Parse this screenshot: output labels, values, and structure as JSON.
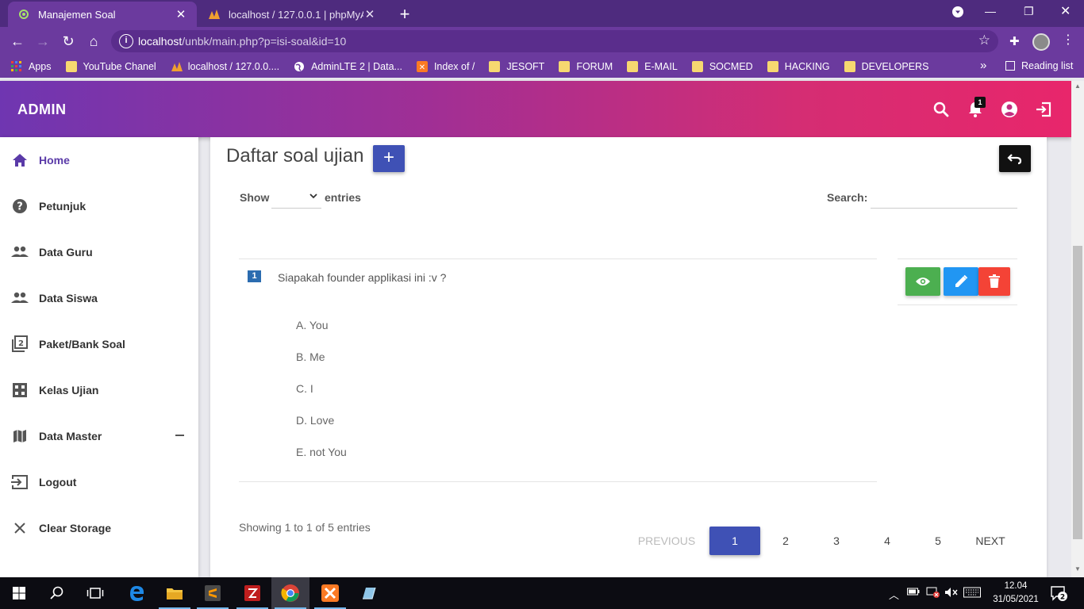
{
  "browser": {
    "tabs": [
      {
        "title": "Manajemen Soal",
        "active": true
      },
      {
        "title": "localhost / 127.0.0.1 | phpMyAdmin",
        "active": false
      }
    ],
    "url_host": "localhost",
    "url_path": "/unbk/main.php?p=isi-soal&id=10",
    "bookmarks": [
      "Apps",
      "YouTube Chanel",
      "localhost / 127.0.0....",
      "AdminLTE 2 | Data...",
      "Index of /",
      "JESOFT",
      "FORUM",
      "E-MAIL",
      "SOCMED",
      "HACKING",
      "DEVELOPERS"
    ],
    "more_bookmarks": "»",
    "reading_list": "Reading list"
  },
  "header": {
    "brand": "ADMIN",
    "notification_count": "1"
  },
  "sidebar": {
    "items": [
      {
        "label": "Home",
        "icon": "home-icon",
        "active": true
      },
      {
        "label": "Petunjuk",
        "icon": "help-icon"
      },
      {
        "label": "Data Guru",
        "icon": "people-icon"
      },
      {
        "label": "Data Siswa",
        "icon": "people-icon"
      },
      {
        "label": "Paket/Bank Soal",
        "icon": "filter-2-icon"
      },
      {
        "label": "Kelas Ujian",
        "icon": "class-icon"
      },
      {
        "label": "Data Master",
        "icon": "map-icon"
      },
      {
        "label": "Logout",
        "icon": "logout-icon"
      },
      {
        "label": "Clear Storage",
        "icon": "close-icon"
      }
    ]
  },
  "main": {
    "title": "Daftar soal ujian",
    "add_label": "+",
    "show_label": "Show",
    "entries_label": "entries",
    "search_label": "Search:",
    "search_value": "",
    "question": {
      "number": "1",
      "text": "Siapakah founder applikasi ini :v ?",
      "options": [
        "A. You",
        "B. Me",
        "C. I",
        "D. Love",
        "E. not You"
      ]
    },
    "info": "Showing 1 to 1 of 5 entries",
    "pagination": {
      "previous": "PREVIOUS",
      "pages": [
        "1",
        "2",
        "3",
        "4",
        "5"
      ],
      "current": "1",
      "next": "NEXT"
    }
  },
  "colors": {
    "primary": "#3f51b5",
    "view": "#4caf50",
    "edit": "#2196f3",
    "delete": "#f44336",
    "sidebar_active": "#5a3aa8"
  },
  "taskbar": {
    "time": "12.04",
    "date": "31/05/2021",
    "notifications": "2"
  }
}
